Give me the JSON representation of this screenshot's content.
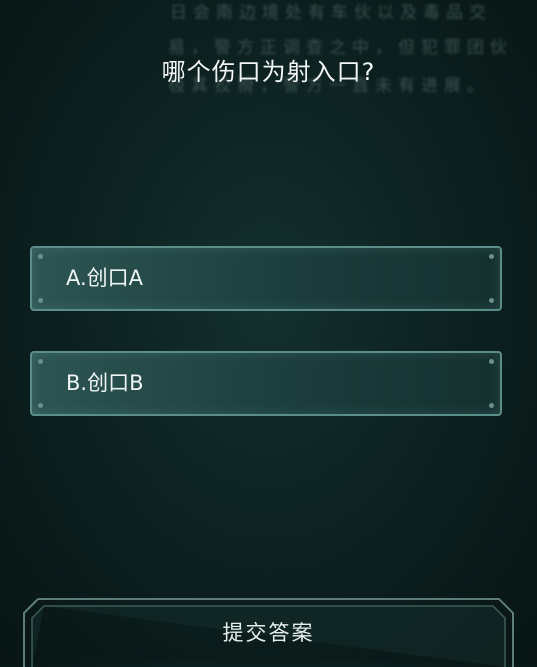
{
  "background": {
    "line1": "日会南边境处有车伙以及毒品交",
    "line2": "易，警方正调查之中，但犯罪团伙",
    "line3": "极其狡猾，警方一直未有进展。"
  },
  "question": "哪个伤口为射入口?",
  "options": [
    {
      "label": "A.创口A"
    },
    {
      "label": "B.创口B"
    }
  ],
  "submit": {
    "label": "提交答案"
  },
  "colors": {
    "accent": "#5b8e8b",
    "background": "#0c1f1f"
  }
}
